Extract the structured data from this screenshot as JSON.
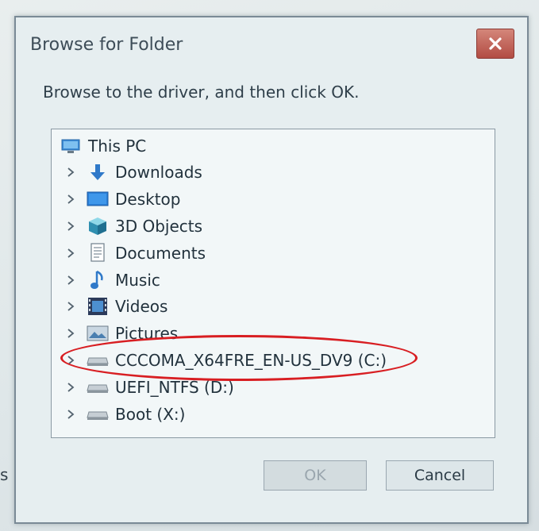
{
  "dialog": {
    "title": "Browse for Folder",
    "close_label": "✕",
    "instruction": "Browse to the driver, and then click OK."
  },
  "tree": {
    "root": {
      "label": "This PC",
      "icon": "computer-icon"
    },
    "items": [
      {
        "label": "Downloads",
        "icon": "download-arrow-icon"
      },
      {
        "label": "Desktop",
        "icon": "desktop-icon"
      },
      {
        "label": "3D Objects",
        "icon": "cube-icon"
      },
      {
        "label": "Documents",
        "icon": "document-icon"
      },
      {
        "label": "Music",
        "icon": "music-note-icon"
      },
      {
        "label": "Videos",
        "icon": "film-icon"
      },
      {
        "label": "Pictures",
        "icon": "picture-icon"
      },
      {
        "label": "CCCOMA_X64FRE_EN-US_DV9 (C:)",
        "icon": "drive-icon"
      },
      {
        "label": "UEFI_NTFS (D:)",
        "icon": "drive-icon"
      },
      {
        "label": "Boot (X:)",
        "icon": "drive-icon"
      }
    ]
  },
  "buttons": {
    "ok": "OK",
    "cancel": "Cancel"
  },
  "background": {
    "partial_text": "s th"
  },
  "colors": {
    "highlight_ellipse": "#d81e22",
    "close_button": "#b24c43",
    "tree_background": "#f2f7f8"
  }
}
